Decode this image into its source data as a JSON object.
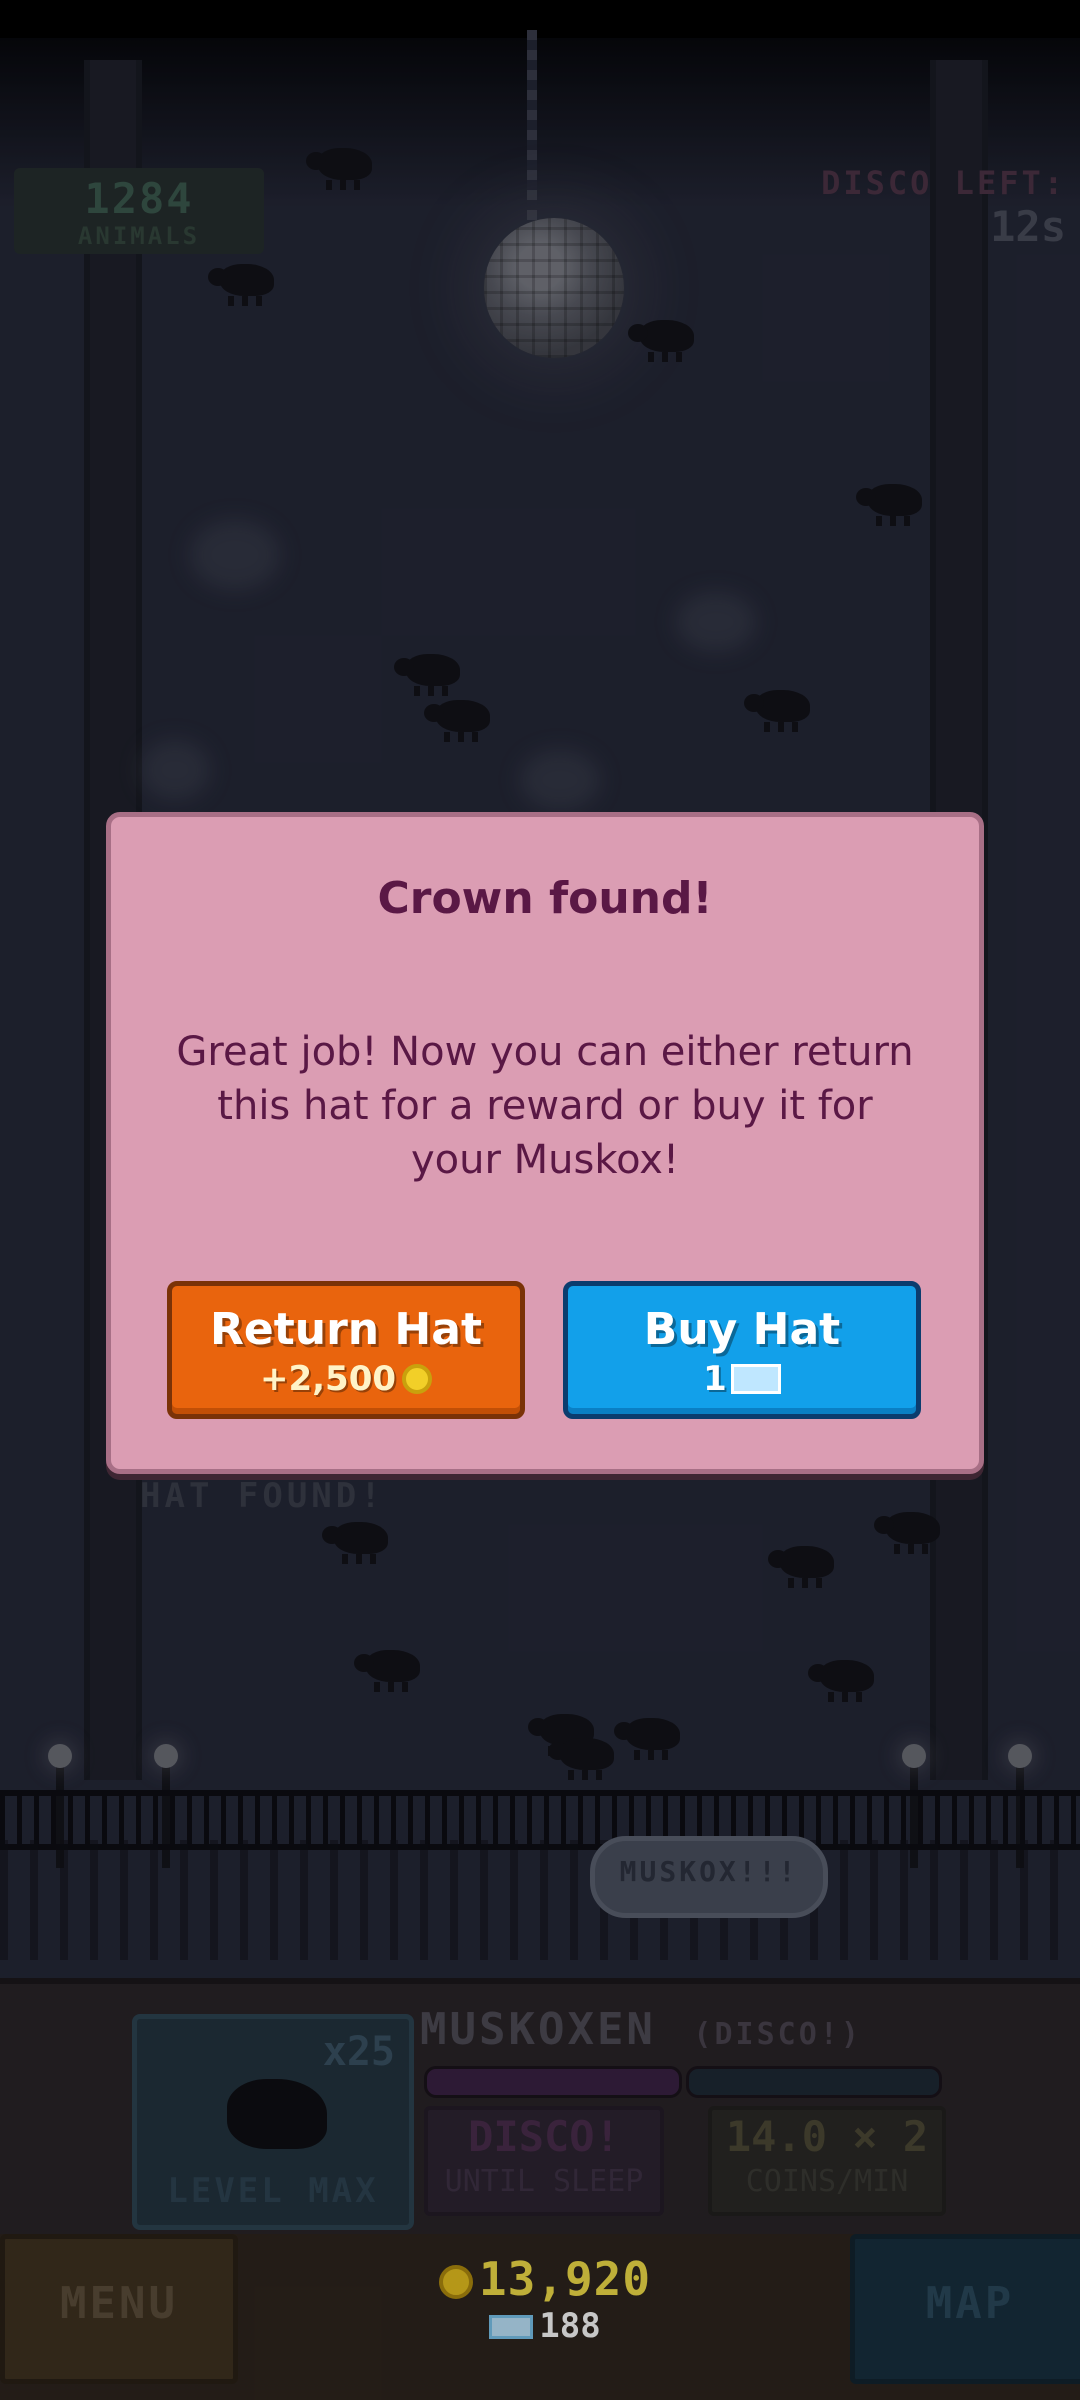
{
  "hud": {
    "animals_count": "1284",
    "animals_label": "ANIMALS",
    "disco_left_label": "DISCO LEFT:",
    "disco_left_value": "12s"
  },
  "game": {
    "hat_found_text": "HAT FOUND!",
    "speech_bubble": "MUSKOX!!!"
  },
  "dialog": {
    "title": "Crown found!",
    "body": "Great job! Now you can either return this hat for a reward or buy it for your Muskox!",
    "return_button": {
      "label": "Return Hat",
      "reward": "+2,500",
      "icon": "coin-icon"
    },
    "buy_button": {
      "label": "Buy Hat",
      "cost": "1",
      "icon": "gem-icon"
    }
  },
  "panel": {
    "animal_name": "MUSKOXEN",
    "animal_status": "(DISCO!)",
    "multiplier": "x25",
    "level_label": "LEVEL MAX",
    "stat_left_value": "DISCO!",
    "stat_left_label": "UNTIL SLEEP",
    "stat_right_value": "14.0 × 2",
    "stat_right_label": "COINS/MIN"
  },
  "bottom_bar": {
    "menu_label": "MENU",
    "map_label": "MAP",
    "coins": "13,920",
    "gems": "188"
  },
  "colors": {
    "dialog_bg": "#db9db3",
    "return_button": "#e9640d",
    "buy_button": "#12a0ea",
    "coins_text": "#f5e14a"
  }
}
